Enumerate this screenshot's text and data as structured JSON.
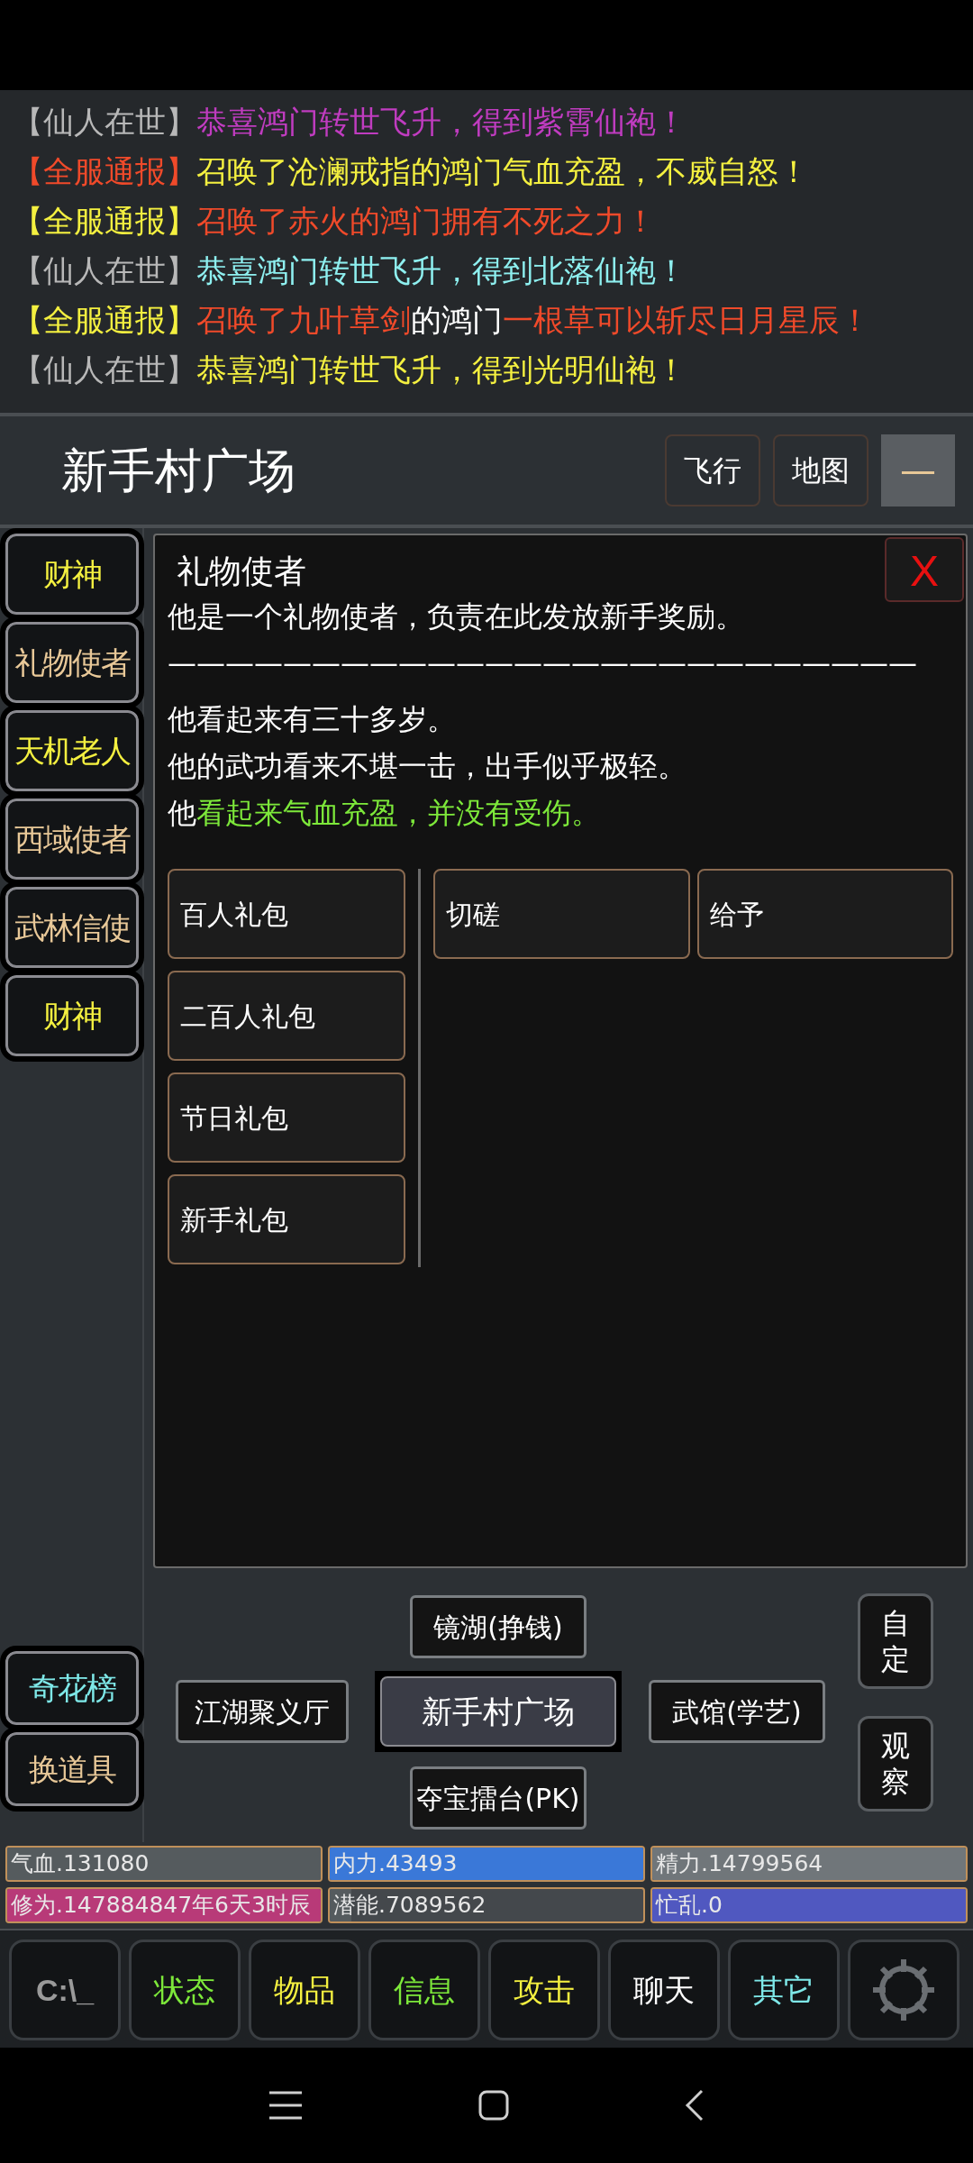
{
  "messages": [
    {
      "parts": [
        {
          "text": "【仙人在世】",
          "color": "#b8b8b8"
        },
        {
          "text": "恭喜鸿门转世飞升，得到紫霄仙袍！",
          "color": "#c03cc0"
        }
      ]
    },
    {
      "parts": [
        {
          "text": "【全服通报】",
          "color": "#f04a2a"
        },
        {
          "text": "召唤了沧澜戒指的鸿门气血充盈，不威自怒！",
          "color": "#f4f040"
        }
      ]
    },
    {
      "parts": [
        {
          "text": "【全服通报】",
          "color": "#f4f040"
        },
        {
          "text": "召唤了赤火的鸿门拥有不死之力！",
          "color": "#f04a2a"
        }
      ]
    },
    {
      "parts": [
        {
          "text": "【仙人在世】",
          "color": "#b8b8b8"
        },
        {
          "text": "恭喜鸿门转世飞升，得到北落仙袍！",
          "color": "#8ef0f0"
        }
      ]
    },
    {
      "parts": [
        {
          "text": "【全服通报】",
          "color": "#f4f040"
        },
        {
          "text": "召唤了九叶草剑",
          "color": "#f04a2a"
        },
        {
          "text": "的鸿门",
          "color": "#ffffff"
        },
        {
          "text": "一根草可以斩尽日月星辰！",
          "color": "#f04a2a"
        }
      ]
    },
    {
      "parts": [
        {
          "text": "【仙人在世】",
          "color": "#b8b8b8"
        },
        {
          "text": "恭喜鸿门转世飞升，得到光明仙袍！",
          "color": "#f4f040"
        }
      ]
    }
  ],
  "location": {
    "title": "新手村广场",
    "buttons": [
      "飞行",
      "地图",
      "—"
    ]
  },
  "npcs": [
    {
      "name": "财神",
      "color": "#f4f040"
    },
    {
      "name": "礼物使者",
      "color": "#e8c898"
    },
    {
      "name": "天机老人",
      "color": "#f4f040"
    },
    {
      "name": "西域使者",
      "color": "#e8c898"
    },
    {
      "name": "武林信使",
      "color": "#e8c898"
    },
    {
      "name": "财神",
      "color": "#f4f040"
    }
  ],
  "dialog": {
    "title": "礼物使者",
    "close": "X",
    "lines": [
      {
        "parts": [
          {
            "text": "他是一个礼物使者，负责在此发放新手奖励。",
            "color": "#ffffff"
          }
        ]
      },
      {
        "parts": [
          {
            "text": "——————————————————————————",
            "color": "#ffffff"
          }
        ]
      },
      {
        "parts": [
          {
            "text": "他看起来有三十多岁。",
            "color": "#ffffff"
          }
        ]
      },
      {
        "parts": [
          {
            "text": "他的武功看来不堪一击，出手似乎极轻。",
            "color": "#ffffff"
          }
        ]
      },
      {
        "parts": [
          {
            "text": "他",
            "color": "#ffffff"
          },
          {
            "text": "看起来气血充盈，并没有受伤。",
            "color": "#7de83a"
          }
        ]
      }
    ],
    "gift_buttons": [
      "百人礼包",
      "二百人礼包",
      "节日礼包",
      "新手礼包"
    ],
    "action_buttons": [
      "切磋",
      "给予"
    ]
  },
  "side_buttons": [
    {
      "name": "奇花榜",
      "color": "#7ee8e8"
    },
    {
      "name": "换道具",
      "color": "#e8c898"
    }
  ],
  "map": {
    "north": "镜湖(挣钱)",
    "west": "江湖聚义厅",
    "center": "新手村广场",
    "east": "武馆(学艺)",
    "south": "夺宝擂台(PK)"
  },
  "map_tools": [
    "自定",
    "观察"
  ],
  "stats": [
    {
      "text": "气血.131080",
      "color": "#555b5e",
      "level": 1
    },
    {
      "text": "内力.43493",
      "color": "#3a78d8",
      "level": 1
    },
    {
      "text": "精力.14799564",
      "color": "#70767a",
      "level": 1
    },
    {
      "text": "修为.147884847年6天3时辰",
      "color": "#b83a78",
      "level": 1
    },
    {
      "text": "潜能.7089562",
      "color": "#555b5e",
      "level": 0.07
    },
    {
      "text": "忙乱.0",
      "color": "#5058c0",
      "level": 1
    }
  ],
  "menu": [
    {
      "kind": "terminal",
      "label": "C:\\_",
      "color": "#9a9a9a"
    },
    {
      "kind": "text",
      "label": "状态",
      "color": "#7de83a"
    },
    {
      "kind": "text",
      "label": "物品",
      "color": "#f4f040"
    },
    {
      "kind": "text",
      "label": "信息",
      "color": "#7de83a"
    },
    {
      "kind": "text",
      "label": "攻击",
      "color": "#f4f040"
    },
    {
      "kind": "text",
      "label": "聊天",
      "color": "#ffffff"
    },
    {
      "kind": "text",
      "label": "其它",
      "color": "#7ee8e8"
    },
    {
      "kind": "emblem",
      "color": "#6a6e72"
    }
  ]
}
